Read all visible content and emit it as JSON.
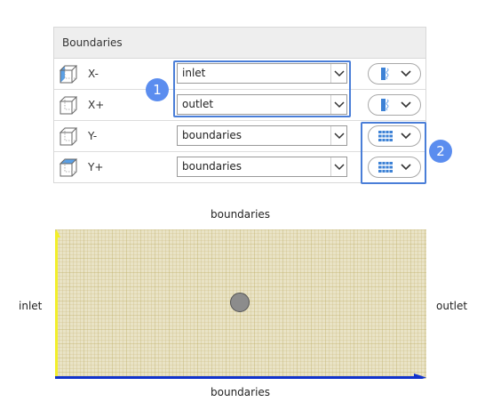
{
  "panel": {
    "title": "Boundaries",
    "rows": [
      {
        "axis": "X-",
        "value": "inlet",
        "face": "x-minus"
      },
      {
        "axis": "X+",
        "value": "outlet",
        "face": "x-plus"
      },
      {
        "axis": "Y-",
        "value": "boundaries",
        "face": "y-minus"
      },
      {
        "axis": "Y+",
        "value": "boundaries",
        "face": "y-plus"
      }
    ]
  },
  "badges": {
    "one": "1",
    "two": "2"
  },
  "preview": {
    "top": "boundaries",
    "bottom": "boundaries",
    "left": "inlet",
    "right": "outlet"
  },
  "colors": {
    "highlight": "#4a7ed8",
    "badge": "#5b8def",
    "mesh": "#cfc187",
    "face": "#5aa0e6",
    "inlet_edge": "#f2ee2a",
    "bottom_edge": "#1133cc"
  },
  "icons": {
    "row_cube": "cube-face-icon",
    "inflow_pattern": "inflow-pattern-icon",
    "wall_pattern": "wall-pattern-icon",
    "dropdown": "chevron-down-icon"
  }
}
